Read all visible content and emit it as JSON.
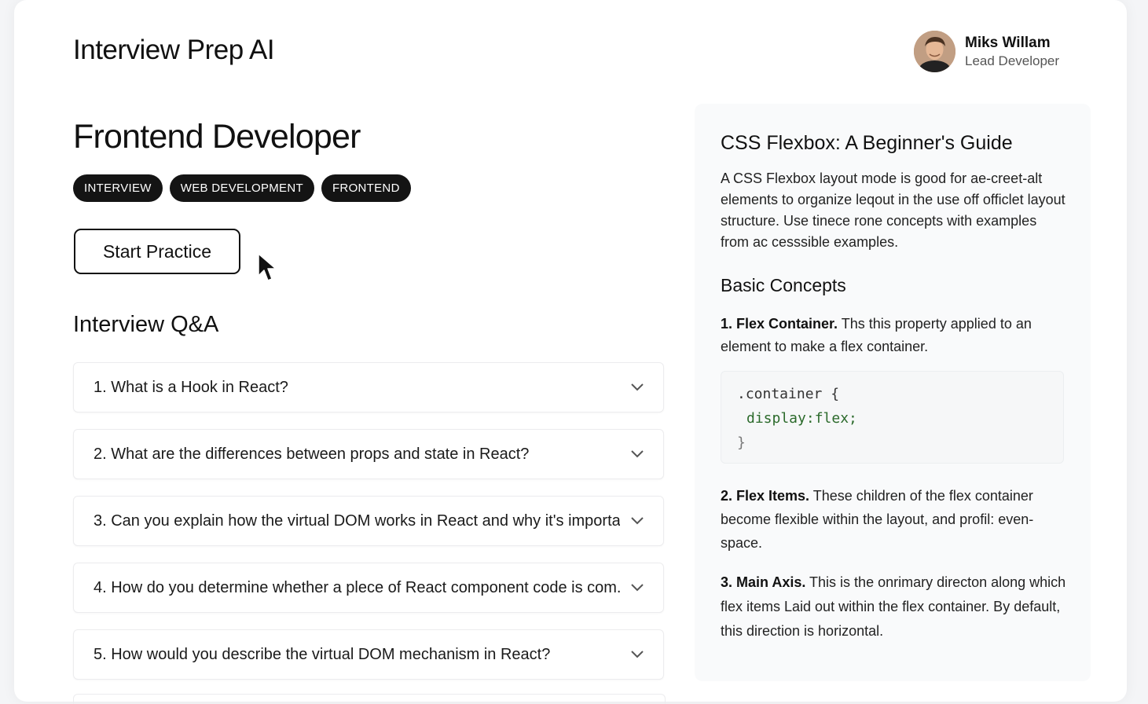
{
  "app": {
    "title": "Interview Prep AI"
  },
  "user": {
    "name": "Miks Willam",
    "role": "Lead Developer"
  },
  "role": {
    "title": "Frontend Developer",
    "tags": [
      "INTERVIEW",
      "WEB DEVELOPMENT",
      "FRONTEND"
    ],
    "start_button": "Start Practice"
  },
  "qa": {
    "heading": "Interview Q&A",
    "items": [
      "1. What is a Hook in React?",
      "2. What are the differences between props and state in React?",
      "3. Can you explain how the virtual DOM works in React and why it's importa",
      "4. How do you determine whether a plece of React component code is com.",
      "5. How would you describe the virtual DOM mechanism in React?"
    ]
  },
  "guide": {
    "title": "CSS Flexbox: A Beginner's Guide",
    "intro": "A CSS Flexbox layout mode is good for ae-creet-alt elements to organize leqout in the use off officlet layout structure. Use tinece rone concepts with examples from ac cesssible examples.",
    "concepts_heading": "Basic Concepts",
    "concepts": [
      {
        "term": "1. Flex Container.",
        "text": " Ths this property applied to an element to make a flex container."
      },
      {
        "term": "2. Flex Items.",
        "text": " These children of the flex container become flexible within the layout, and profil: even-space."
      },
      {
        "term": "3. Main Axis.",
        "text": " This is the onrimary directon along which flex items Laid out within the flex container. By default, this direction is horizontal."
      }
    ],
    "code": [
      ".container {",
      "display:flex;",
      "}"
    ]
  },
  "colors": {
    "tag_bg": "#141414",
    "tag_text": "#ffffff",
    "accent": "#111111",
    "panel_bg": "#f9fafb"
  },
  "icons": {
    "chevron": "chevron-down-icon",
    "cursor": "mouse-pointer-icon",
    "avatar": "user-avatar"
  }
}
